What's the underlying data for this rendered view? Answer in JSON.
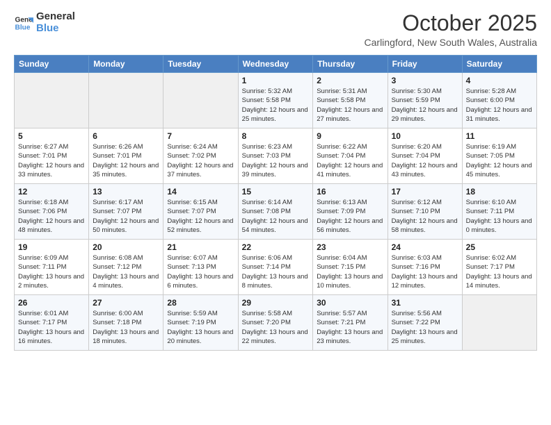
{
  "logo": {
    "text_general": "General",
    "text_blue": "Blue"
  },
  "header": {
    "month_title": "October 2025",
    "location": "Carlingford, New South Wales, Australia"
  },
  "days_of_week": [
    "Sunday",
    "Monday",
    "Tuesday",
    "Wednesday",
    "Thursday",
    "Friday",
    "Saturday"
  ],
  "weeks": [
    [
      {
        "day": "",
        "info": ""
      },
      {
        "day": "",
        "info": ""
      },
      {
        "day": "",
        "info": ""
      },
      {
        "day": "1",
        "info": "Sunrise: 5:32 AM\nSunset: 5:58 PM\nDaylight: 12 hours\nand 25 minutes."
      },
      {
        "day": "2",
        "info": "Sunrise: 5:31 AM\nSunset: 5:58 PM\nDaylight: 12 hours\nand 27 minutes."
      },
      {
        "day": "3",
        "info": "Sunrise: 5:30 AM\nSunset: 5:59 PM\nDaylight: 12 hours\nand 29 minutes."
      },
      {
        "day": "4",
        "info": "Sunrise: 5:28 AM\nSunset: 6:00 PM\nDaylight: 12 hours\nand 31 minutes."
      }
    ],
    [
      {
        "day": "5",
        "info": "Sunrise: 6:27 AM\nSunset: 7:01 PM\nDaylight: 12 hours\nand 33 minutes."
      },
      {
        "day": "6",
        "info": "Sunrise: 6:26 AM\nSunset: 7:01 PM\nDaylight: 12 hours\nand 35 minutes."
      },
      {
        "day": "7",
        "info": "Sunrise: 6:24 AM\nSunset: 7:02 PM\nDaylight: 12 hours\nand 37 minutes."
      },
      {
        "day": "8",
        "info": "Sunrise: 6:23 AM\nSunset: 7:03 PM\nDaylight: 12 hours\nand 39 minutes."
      },
      {
        "day": "9",
        "info": "Sunrise: 6:22 AM\nSunset: 7:04 PM\nDaylight: 12 hours\nand 41 minutes."
      },
      {
        "day": "10",
        "info": "Sunrise: 6:20 AM\nSunset: 7:04 PM\nDaylight: 12 hours\nand 43 minutes."
      },
      {
        "day": "11",
        "info": "Sunrise: 6:19 AM\nSunset: 7:05 PM\nDaylight: 12 hours\nand 45 minutes."
      }
    ],
    [
      {
        "day": "12",
        "info": "Sunrise: 6:18 AM\nSunset: 7:06 PM\nDaylight: 12 hours\nand 48 minutes."
      },
      {
        "day": "13",
        "info": "Sunrise: 6:17 AM\nSunset: 7:07 PM\nDaylight: 12 hours\nand 50 minutes."
      },
      {
        "day": "14",
        "info": "Sunrise: 6:15 AM\nSunset: 7:07 PM\nDaylight: 12 hours\nand 52 minutes."
      },
      {
        "day": "15",
        "info": "Sunrise: 6:14 AM\nSunset: 7:08 PM\nDaylight: 12 hours\nand 54 minutes."
      },
      {
        "day": "16",
        "info": "Sunrise: 6:13 AM\nSunset: 7:09 PM\nDaylight: 12 hours\nand 56 minutes."
      },
      {
        "day": "17",
        "info": "Sunrise: 6:12 AM\nSunset: 7:10 PM\nDaylight: 12 hours\nand 58 minutes."
      },
      {
        "day": "18",
        "info": "Sunrise: 6:10 AM\nSunset: 7:11 PM\nDaylight: 13 hours\nand 0 minutes."
      }
    ],
    [
      {
        "day": "19",
        "info": "Sunrise: 6:09 AM\nSunset: 7:11 PM\nDaylight: 13 hours\nand 2 minutes."
      },
      {
        "day": "20",
        "info": "Sunrise: 6:08 AM\nSunset: 7:12 PM\nDaylight: 13 hours\nand 4 minutes."
      },
      {
        "day": "21",
        "info": "Sunrise: 6:07 AM\nSunset: 7:13 PM\nDaylight: 13 hours\nand 6 minutes."
      },
      {
        "day": "22",
        "info": "Sunrise: 6:06 AM\nSunset: 7:14 PM\nDaylight: 13 hours\nand 8 minutes."
      },
      {
        "day": "23",
        "info": "Sunrise: 6:04 AM\nSunset: 7:15 PM\nDaylight: 13 hours\nand 10 minutes."
      },
      {
        "day": "24",
        "info": "Sunrise: 6:03 AM\nSunset: 7:16 PM\nDaylight: 13 hours\nand 12 minutes."
      },
      {
        "day": "25",
        "info": "Sunrise: 6:02 AM\nSunset: 7:17 PM\nDaylight: 13 hours\nand 14 minutes."
      }
    ],
    [
      {
        "day": "26",
        "info": "Sunrise: 6:01 AM\nSunset: 7:17 PM\nDaylight: 13 hours\nand 16 minutes."
      },
      {
        "day": "27",
        "info": "Sunrise: 6:00 AM\nSunset: 7:18 PM\nDaylight: 13 hours\nand 18 minutes."
      },
      {
        "day": "28",
        "info": "Sunrise: 5:59 AM\nSunset: 7:19 PM\nDaylight: 13 hours\nand 20 minutes."
      },
      {
        "day": "29",
        "info": "Sunrise: 5:58 AM\nSunset: 7:20 PM\nDaylight: 13 hours\nand 22 minutes."
      },
      {
        "day": "30",
        "info": "Sunrise: 5:57 AM\nSunset: 7:21 PM\nDaylight: 13 hours\nand 23 minutes."
      },
      {
        "day": "31",
        "info": "Sunrise: 5:56 AM\nSunset: 7:22 PM\nDaylight: 13 hours\nand 25 minutes."
      },
      {
        "day": "",
        "info": ""
      }
    ]
  ]
}
